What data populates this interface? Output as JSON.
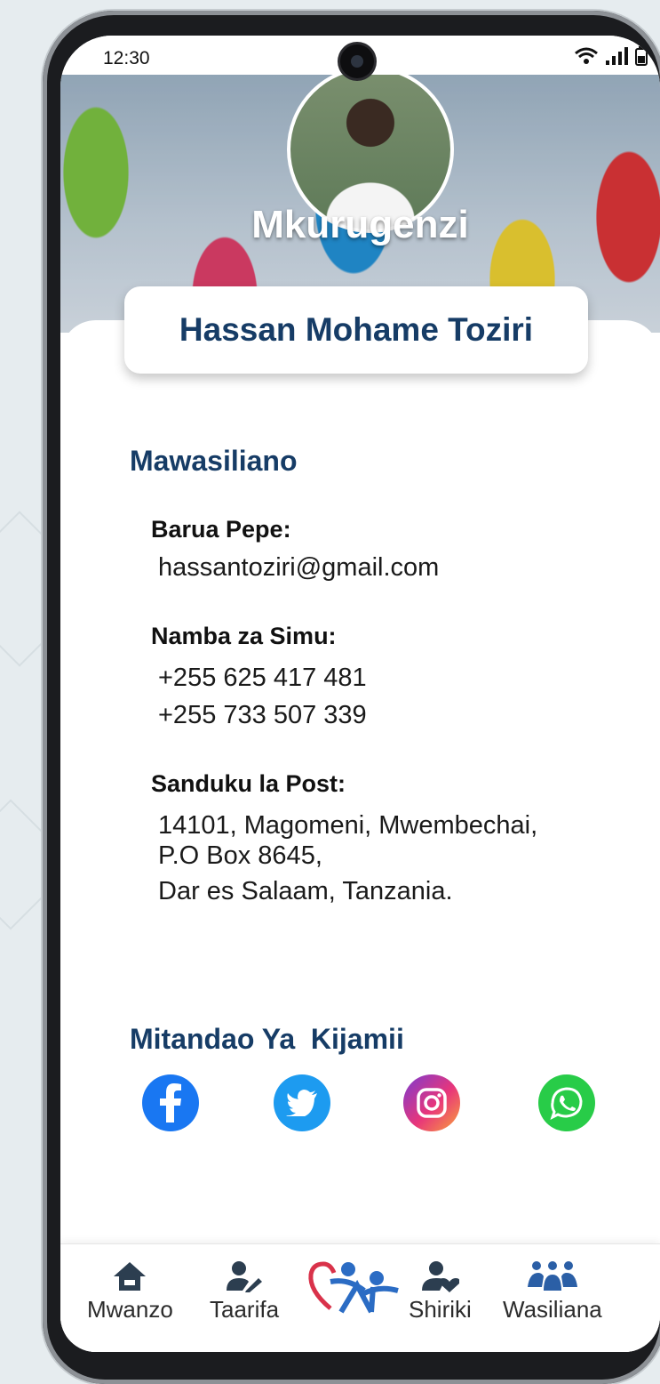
{
  "status_bar": {
    "time": "12:30"
  },
  "profile": {
    "role": "Mkurugenzi",
    "name": "Hassan Mohame Toziri"
  },
  "contact": {
    "title": "Mawasiliano",
    "email_label": "Barua Pepe:",
    "email": "hassantoziri@gmail.com",
    "phone_label": "Namba za Simu:",
    "phones": [
      "+255 625 417 481",
      "+255 733 507 339"
    ],
    "address_label": "Sanduku la Post:",
    "address_lines": [
      "14101, Magomeni, Mwembechai,",
      "P.O Box 8645,",
      "Dar es Salaam, Tanzania."
    ]
  },
  "social": {
    "title": "Mitandao Ya  Kijamii",
    "icons": [
      "facebook-icon",
      "twitter-icon",
      "instagram-icon",
      "whatsapp-icon"
    ]
  },
  "nav": {
    "items": [
      {
        "label": "Mwanzo",
        "icon": "home-icon"
      },
      {
        "label": "Taarifa",
        "icon": "user-edit-icon"
      },
      {
        "label": "",
        "icon": "logo-icon"
      },
      {
        "label": "Shiriki",
        "icon": "user-heart-icon"
      },
      {
        "label": "Wasiliana",
        "icon": "people-group-icon"
      }
    ]
  },
  "colors": {
    "primary": "#163c66",
    "facebook": "#1977f2",
    "twitter": "#1d9bf0",
    "whatsapp": "#28cc48",
    "nav_icon": "#2c3e50",
    "logo_red": "#d9324a",
    "logo_blue": "#2b6cc4"
  }
}
